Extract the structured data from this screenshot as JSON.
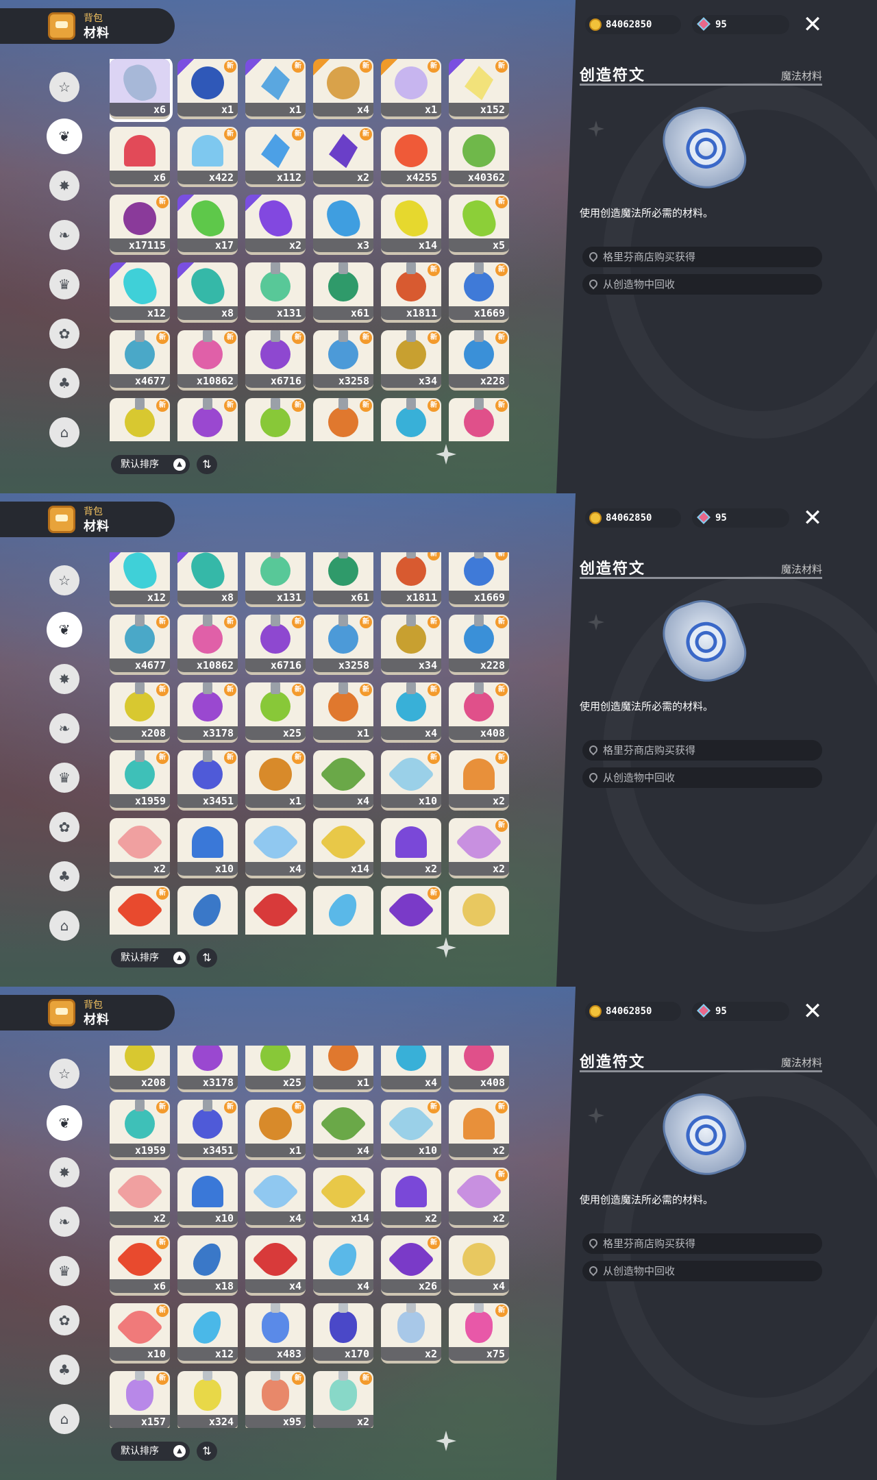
{
  "header": {
    "subtitle": "背包",
    "title": "材料"
  },
  "sidebar": [
    {
      "name": "star-badge-icon",
      "glyph": "☆"
    },
    {
      "name": "leaf-icon",
      "glyph": "❦",
      "active": true
    },
    {
      "name": "spark-badge-icon",
      "glyph": "✸"
    },
    {
      "name": "sprout-icon",
      "glyph": "❧"
    },
    {
      "name": "crown-card-icon",
      "glyph": "♛"
    },
    {
      "name": "flower-icon",
      "glyph": "✿"
    },
    {
      "name": "acorn-icon",
      "glyph": "♣"
    },
    {
      "name": "sofa-icon",
      "glyph": "⌂"
    }
  ],
  "currency": {
    "coins": "84062850",
    "gems": "95"
  },
  "detail": {
    "title": "创造符文",
    "category": "魔法材料",
    "description": "使用创造魔法所必需的材料。",
    "sources": [
      "格里芬商店购买获得",
      "从创造物中回收"
    ]
  },
  "sort": {
    "label": "默认排序"
  },
  "panels": [
    {
      "items": [
        {
          "c": "x6",
          "col": "#a7b8d8",
          "s": "rock",
          "sel": true
        },
        {
          "c": "x1",
          "col": "#2f58b8",
          "s": "round",
          "n": true,
          "t": "p"
        },
        {
          "c": "x1",
          "col": "#5aa7e0",
          "s": "gem",
          "n": true,
          "t": "p"
        },
        {
          "c": "x4",
          "col": "#d9a24a",
          "s": "round",
          "n": true,
          "t": "o"
        },
        {
          "c": "x1",
          "col": "#c7b5ef",
          "s": "round",
          "n": true,
          "t": "o"
        },
        {
          "c": "x152",
          "col": "#f2e27a",
          "s": "gem",
          "n": true,
          "t": "p"
        },
        {
          "c": "x6",
          "col": "#e24a58",
          "s": "cone"
        },
        {
          "c": "x422",
          "col": "#7ec8ef",
          "s": "cone",
          "n": true
        },
        {
          "c": "x112",
          "col": "#4ca0e6",
          "s": "gem",
          "n": true
        },
        {
          "c": "x2",
          "col": "#6a3fc8",
          "s": "gem",
          "n": true
        },
        {
          "c": "x4255",
          "col": "#ef5a38",
          "s": "round"
        },
        {
          "c": "x40362",
          "col": "#6fb84a",
          "s": "round"
        },
        {
          "c": "x17115",
          "col": "#8a3a9a",
          "s": "round",
          "n": true
        },
        {
          "c": "x17",
          "col": "#5ec84a",
          "s": "rock",
          "t": "p"
        },
        {
          "c": "x2",
          "col": "#8248e0",
          "s": "rock",
          "t": "p"
        },
        {
          "c": "x3",
          "col": "#3f9ee0",
          "s": "rock"
        },
        {
          "c": "x14",
          "col": "#e6d82e",
          "s": "rock"
        },
        {
          "c": "x5",
          "col": "#8ccf38",
          "s": "rock",
          "n": true
        },
        {
          "c": "x12",
          "col": "#3fd0d8",
          "s": "rock",
          "t": "p"
        },
        {
          "c": "x8",
          "col": "#35b8a8",
          "s": "rock",
          "t": "p"
        },
        {
          "c": "x131",
          "col": "#58c898",
          "s": "flask"
        },
        {
          "c": "x61",
          "col": "#2f9a6a",
          "s": "flask"
        },
        {
          "c": "x1811",
          "col": "#d85a30",
          "s": "flask",
          "n": true
        },
        {
          "c": "x1669",
          "col": "#3f7ad8",
          "s": "flask",
          "n": true
        },
        {
          "c": "x4677",
          "col": "#4aa8c8",
          "s": "flask",
          "n": true
        },
        {
          "c": "x10862",
          "col": "#e060a8",
          "s": "flask",
          "n": true
        },
        {
          "c": "x6716",
          "col": "#8e48d0",
          "s": "flask",
          "n": true
        },
        {
          "c": "x3258",
          "col": "#4c9ad8",
          "s": "flask",
          "n": true
        },
        {
          "c": "x34",
          "col": "#c8a030",
          "s": "flask",
          "n": true
        },
        {
          "c": "x228",
          "col": "#3a90d8",
          "s": "flask",
          "n": true
        },
        {
          "c": "",
          "col": "#d8c830",
          "s": "flask",
          "n": true
        },
        {
          "c": "",
          "col": "#9a48d0",
          "s": "flask",
          "n": true
        },
        {
          "c": "",
          "col": "#88c838",
          "s": "flask",
          "n": true
        },
        {
          "c": "",
          "col": "#e0782e",
          "s": "flask",
          "n": true
        },
        {
          "c": "",
          "col": "#38b0d8",
          "s": "flask",
          "n": true
        },
        {
          "c": "",
          "col": "#e0508a",
          "s": "flask",
          "n": true
        }
      ]
    },
    {
      "items": [
        {
          "c": "x12",
          "col": "#3fd0d8",
          "s": "rock",
          "t": "p"
        },
        {
          "c": "x8",
          "col": "#35b8a8",
          "s": "rock",
          "t": "p"
        },
        {
          "c": "x131",
          "col": "#58c898",
          "s": "flask"
        },
        {
          "c": "x61",
          "col": "#2f9a6a",
          "s": "flask"
        },
        {
          "c": "x1811",
          "col": "#d85a30",
          "s": "flask",
          "n": true
        },
        {
          "c": "x1669",
          "col": "#3f7ad8",
          "s": "flask",
          "n": true
        },
        {
          "c": "x4677",
          "col": "#4aa8c8",
          "s": "flask",
          "n": true
        },
        {
          "c": "x10862",
          "col": "#e060a8",
          "s": "flask",
          "n": true
        },
        {
          "c": "x6716",
          "col": "#8e48d0",
          "s": "flask",
          "n": true
        },
        {
          "c": "x3258",
          "col": "#4c9ad8",
          "s": "flask",
          "n": true
        },
        {
          "c": "x34",
          "col": "#c8a030",
          "s": "flask",
          "n": true
        },
        {
          "c": "x228",
          "col": "#3a90d8",
          "s": "flask",
          "n": true
        },
        {
          "c": "x208",
          "col": "#d8c830",
          "s": "flask",
          "n": true
        },
        {
          "c": "x3178",
          "col": "#9a48d0",
          "s": "flask",
          "n": true
        },
        {
          "c": "x25",
          "col": "#88c838",
          "s": "flask",
          "n": true
        },
        {
          "c": "x1",
          "col": "#e0782e",
          "s": "flask",
          "n": true
        },
        {
          "c": "x4",
          "col": "#38b0d8",
          "s": "flask",
          "n": true
        },
        {
          "c": "x408",
          "col": "#e0508a",
          "s": "flask",
          "n": true
        },
        {
          "c": "x1959",
          "col": "#3ec0b8",
          "s": "flask",
          "n": true
        },
        {
          "c": "x3451",
          "col": "#4f5ad8",
          "s": "flask",
          "n": true
        },
        {
          "c": "x1",
          "col": "#d88a2a",
          "s": "round",
          "n": true
        },
        {
          "c": "x4",
          "col": "#6aa848",
          "s": "flower"
        },
        {
          "c": "x10",
          "col": "#9ad0e8",
          "s": "flower",
          "n": true
        },
        {
          "c": "x2",
          "col": "#e8903a",
          "s": "cone",
          "n": true
        },
        {
          "c": "x2",
          "col": "#f0a0a0",
          "s": "flower"
        },
        {
          "c": "x10",
          "col": "#3a78d8",
          "s": "cone"
        },
        {
          "c": "x4",
          "col": "#90c8f0",
          "s": "flower"
        },
        {
          "c": "x14",
          "col": "#e8c848",
          "s": "flower"
        },
        {
          "c": "x2",
          "col": "#7a48d8",
          "s": "cone"
        },
        {
          "c": "x2",
          "col": "#c890e0",
          "s": "flower",
          "n": true
        },
        {
          "c": "",
          "col": "#e84a2e",
          "s": "flower",
          "n": true
        },
        {
          "c": "",
          "col": "#3a78c8",
          "s": "drop"
        },
        {
          "c": "",
          "col": "#d83a3a",
          "s": "flower"
        },
        {
          "c": "",
          "col": "#5ab8e8",
          "s": "drop"
        },
        {
          "c": "",
          "col": "#7a3ac8",
          "s": "flower",
          "n": true
        },
        {
          "c": "",
          "col": "#e8c860",
          "s": "round"
        }
      ]
    },
    {
      "items": [
        {
          "c": "x208",
          "col": "#d8c830",
          "s": "flask",
          "n": true
        },
        {
          "c": "x3178",
          "col": "#9a48d0",
          "s": "flask",
          "n": true
        },
        {
          "c": "x25",
          "col": "#88c838",
          "s": "flask",
          "n": true
        },
        {
          "c": "x1",
          "col": "#e0782e",
          "s": "flask",
          "n": true
        },
        {
          "c": "x4",
          "col": "#38b0d8",
          "s": "flask",
          "n": true
        },
        {
          "c": "x408",
          "col": "#e0508a",
          "s": "flask",
          "n": true
        },
        {
          "c": "x1959",
          "col": "#3ec0b8",
          "s": "flask",
          "n": true
        },
        {
          "c": "x3451",
          "col": "#4f5ad8",
          "s": "flask",
          "n": true
        },
        {
          "c": "x1",
          "col": "#d88a2a",
          "s": "round",
          "n": true
        },
        {
          "c": "x4",
          "col": "#6aa848",
          "s": "flower"
        },
        {
          "c": "x10",
          "col": "#9ad0e8",
          "s": "flower",
          "n": true
        },
        {
          "c": "x2",
          "col": "#e8903a",
          "s": "cone",
          "n": true
        },
        {
          "c": "x2",
          "col": "#f0a0a0",
          "s": "flower"
        },
        {
          "c": "x10",
          "col": "#3a78d8",
          "s": "cone"
        },
        {
          "c": "x4",
          "col": "#90c8f0",
          "s": "flower"
        },
        {
          "c": "x14",
          "col": "#e8c848",
          "s": "flower"
        },
        {
          "c": "x2",
          "col": "#7a48d8",
          "s": "cone"
        },
        {
          "c": "x2",
          "col": "#c890e0",
          "s": "flower",
          "n": true
        },
        {
          "c": "x6",
          "col": "#e84a2e",
          "s": "flower",
          "n": true
        },
        {
          "c": "x18",
          "col": "#3a78c8",
          "s": "drop"
        },
        {
          "c": "x4",
          "col": "#d83a3a",
          "s": "flower"
        },
        {
          "c": "x4",
          "col": "#5ab8e8",
          "s": "drop"
        },
        {
          "c": "x26",
          "col": "#7a3ac8",
          "s": "flower",
          "n": true
        },
        {
          "c": "x4",
          "col": "#e8c860",
          "s": "round"
        },
        {
          "c": "x10",
          "col": "#f07a7a",
          "s": "flower",
          "n": true
        },
        {
          "c": "x12",
          "col": "#4ab8e8",
          "s": "drop"
        },
        {
          "c": "x483",
          "col": "#5a8ae8",
          "s": "bottle"
        },
        {
          "c": "x170",
          "col": "#4a48c8",
          "s": "bottle"
        },
        {
          "c": "x2",
          "col": "#a8c8e8",
          "s": "bottle"
        },
        {
          "c": "x75",
          "col": "#e858a8",
          "s": "bottle",
          "n": true
        },
        {
          "c": "x157",
          "col": "#b888e8",
          "s": "bottle",
          "n": true
        },
        {
          "c": "x324",
          "col": "#e8d848",
          "s": "bottle"
        },
        {
          "c": "x95",
          "col": "#e8886a",
          "s": "bottle",
          "n": true
        },
        {
          "c": "x2",
          "col": "#88d8c8",
          "s": "bottle",
          "n": true
        }
      ]
    }
  ]
}
